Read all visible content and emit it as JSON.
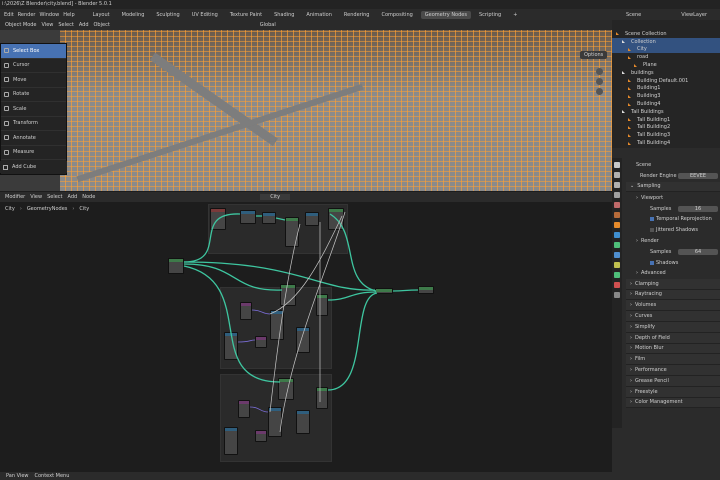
{
  "window": {
    "title": "i:\\2026\\Z Blender\\city.blend] - Blender 5.0.1"
  },
  "menu": [
    "Edit",
    "Render",
    "Window",
    "Help"
  ],
  "tabs": [
    "Layout",
    "Modeling",
    "Sculpting",
    "UV Editing",
    "Texture Paint",
    "Shading",
    "Animation",
    "Rendering",
    "Compositing",
    "Geometry Nodes",
    "Scripting",
    "+"
  ],
  "active_tab": "Geometry Nodes",
  "scene": {
    "name": "Scene",
    "view_layer": "ViewLayer"
  },
  "viewport": {
    "mode": "Object Mode",
    "menus": [
      "View",
      "Select",
      "Add",
      "Object"
    ],
    "orientation": "Global",
    "options": "Options"
  },
  "tools": [
    {
      "label": "Select Box",
      "active": true
    },
    {
      "label": "Cursor"
    },
    {
      "label": "Move"
    },
    {
      "label": "Rotate"
    },
    {
      "label": "Scale"
    },
    {
      "label": "Transform"
    },
    {
      "label": "Annotate"
    },
    {
      "label": "Measure"
    }
  ],
  "add_cube": "Add Cube",
  "node_editor": {
    "type": "Modifier",
    "menus": [
      "View",
      "Select",
      "Add",
      "Node"
    ],
    "object": "City",
    "breadcrumb": [
      "City",
      "GeometryNodes",
      "City"
    ]
  },
  "outliner": {
    "search_placeholder": "",
    "rows": [
      {
        "label": "Scene Collection",
        "indent": 0
      },
      {
        "label": "Collection",
        "indent": 1,
        "selected": true
      },
      {
        "label": "City",
        "indent": 2,
        "selected": true
      },
      {
        "label": "road",
        "indent": 2
      },
      {
        "label": "Plane",
        "indent": 3
      },
      {
        "label": "buildings",
        "indent": 1
      },
      {
        "label": "Building Default.001",
        "indent": 2
      },
      {
        "label": "Building1",
        "indent": 2
      },
      {
        "label": "Building3",
        "indent": 2
      },
      {
        "label": "Building4",
        "indent": 2
      },
      {
        "label": "Tall Buildings",
        "indent": 1
      },
      {
        "label": "Tall Building1",
        "indent": 2
      },
      {
        "label": "Tall Building2",
        "indent": 2
      },
      {
        "label": "Tall Building3",
        "indent": 2
      },
      {
        "label": "Tall Building4",
        "indent": 2
      }
    ]
  },
  "properties": {
    "scene_label": "Scene",
    "render_engine_label": "Render Engine",
    "render_engine": "EEVEE",
    "rows": [
      {
        "label": "Sampling",
        "type": "panel",
        "open": true
      },
      {
        "label": "Viewport",
        "type": "sub"
      },
      {
        "label": "Samples",
        "type": "field",
        "value": "16"
      },
      {
        "label": "Temporal Reprojection",
        "type": "check",
        "checked": true
      },
      {
        "label": "Jittered Shadows",
        "type": "check",
        "checked": false
      },
      {
        "label": "Render",
        "type": "sub"
      },
      {
        "label": "Samples",
        "type": "field",
        "value": "64"
      },
      {
        "label": "Shadows",
        "type": "check",
        "checked": true
      },
      {
        "label": "Advanced",
        "type": "sub"
      },
      {
        "label": "Clamping",
        "type": "panel"
      },
      {
        "label": "Raytracing",
        "type": "panel"
      },
      {
        "label": "Volumes",
        "type": "panel"
      },
      {
        "label": "Curves",
        "type": "panel"
      },
      {
        "label": "Simplify",
        "type": "panel"
      },
      {
        "label": "Depth of Field",
        "type": "panel"
      },
      {
        "label": "Motion Blur",
        "type": "panel"
      },
      {
        "label": "Film",
        "type": "panel"
      },
      {
        "label": "Performance",
        "type": "panel"
      },
      {
        "label": "Grease Pencil",
        "type": "panel"
      },
      {
        "label": "Freestyle",
        "type": "panel"
      },
      {
        "label": "Color Management",
        "type": "panel"
      }
    ]
  },
  "status": {
    "left": "Pan View",
    "right": "Context Menu"
  },
  "colors": {
    "accent": "#4772b3",
    "selection": "#e58a2b",
    "node_link": "#3ec6a0"
  }
}
